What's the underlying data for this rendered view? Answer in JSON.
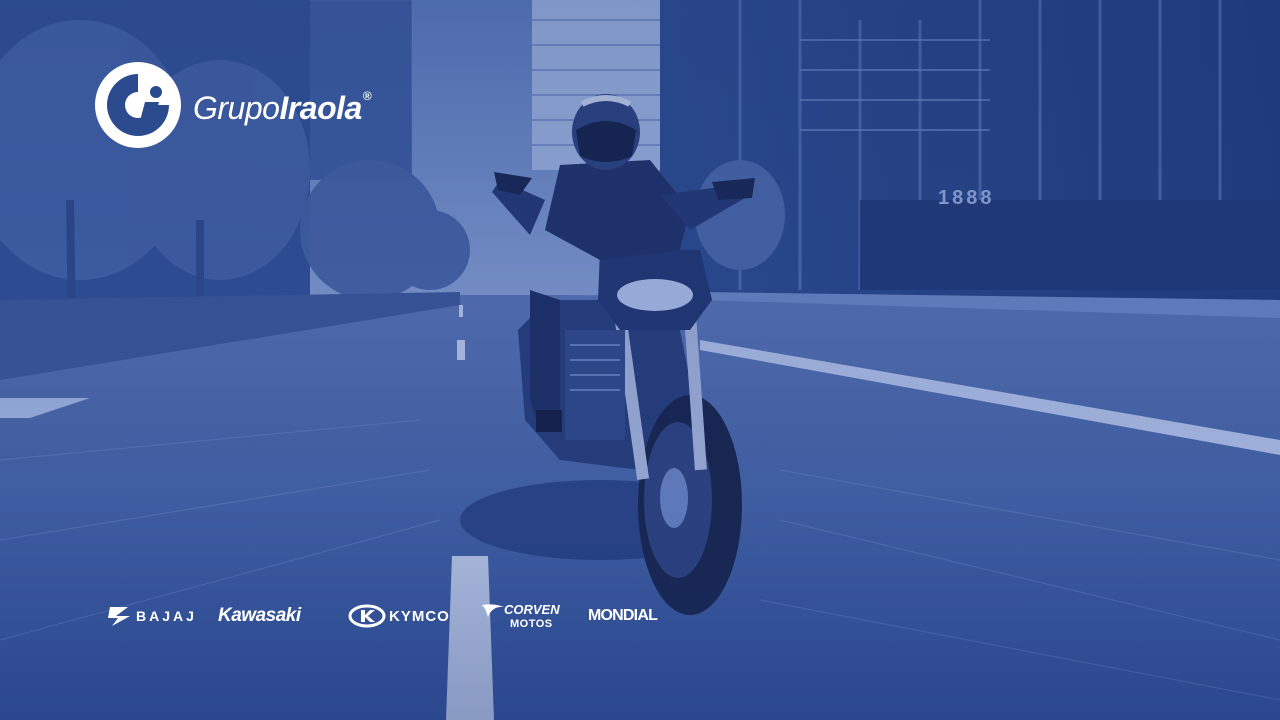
{
  "logo": {
    "word_light": "Grupo",
    "word_bold": "Iraola",
    "registered": "®"
  },
  "brands": {
    "bajaj": "BAJAJ",
    "kawasaki": "Kawasaki",
    "kymco": "KYMCO",
    "corven_top": "CORVEN",
    "corven_bottom": "MOTOS",
    "mondial": "MONDIAL"
  },
  "building_number": "1888",
  "colors": {
    "overlay": "#2c4a8e",
    "overlay_dark": "#1c3370",
    "road": "#3a5aa0",
    "white": "#ffffff"
  }
}
